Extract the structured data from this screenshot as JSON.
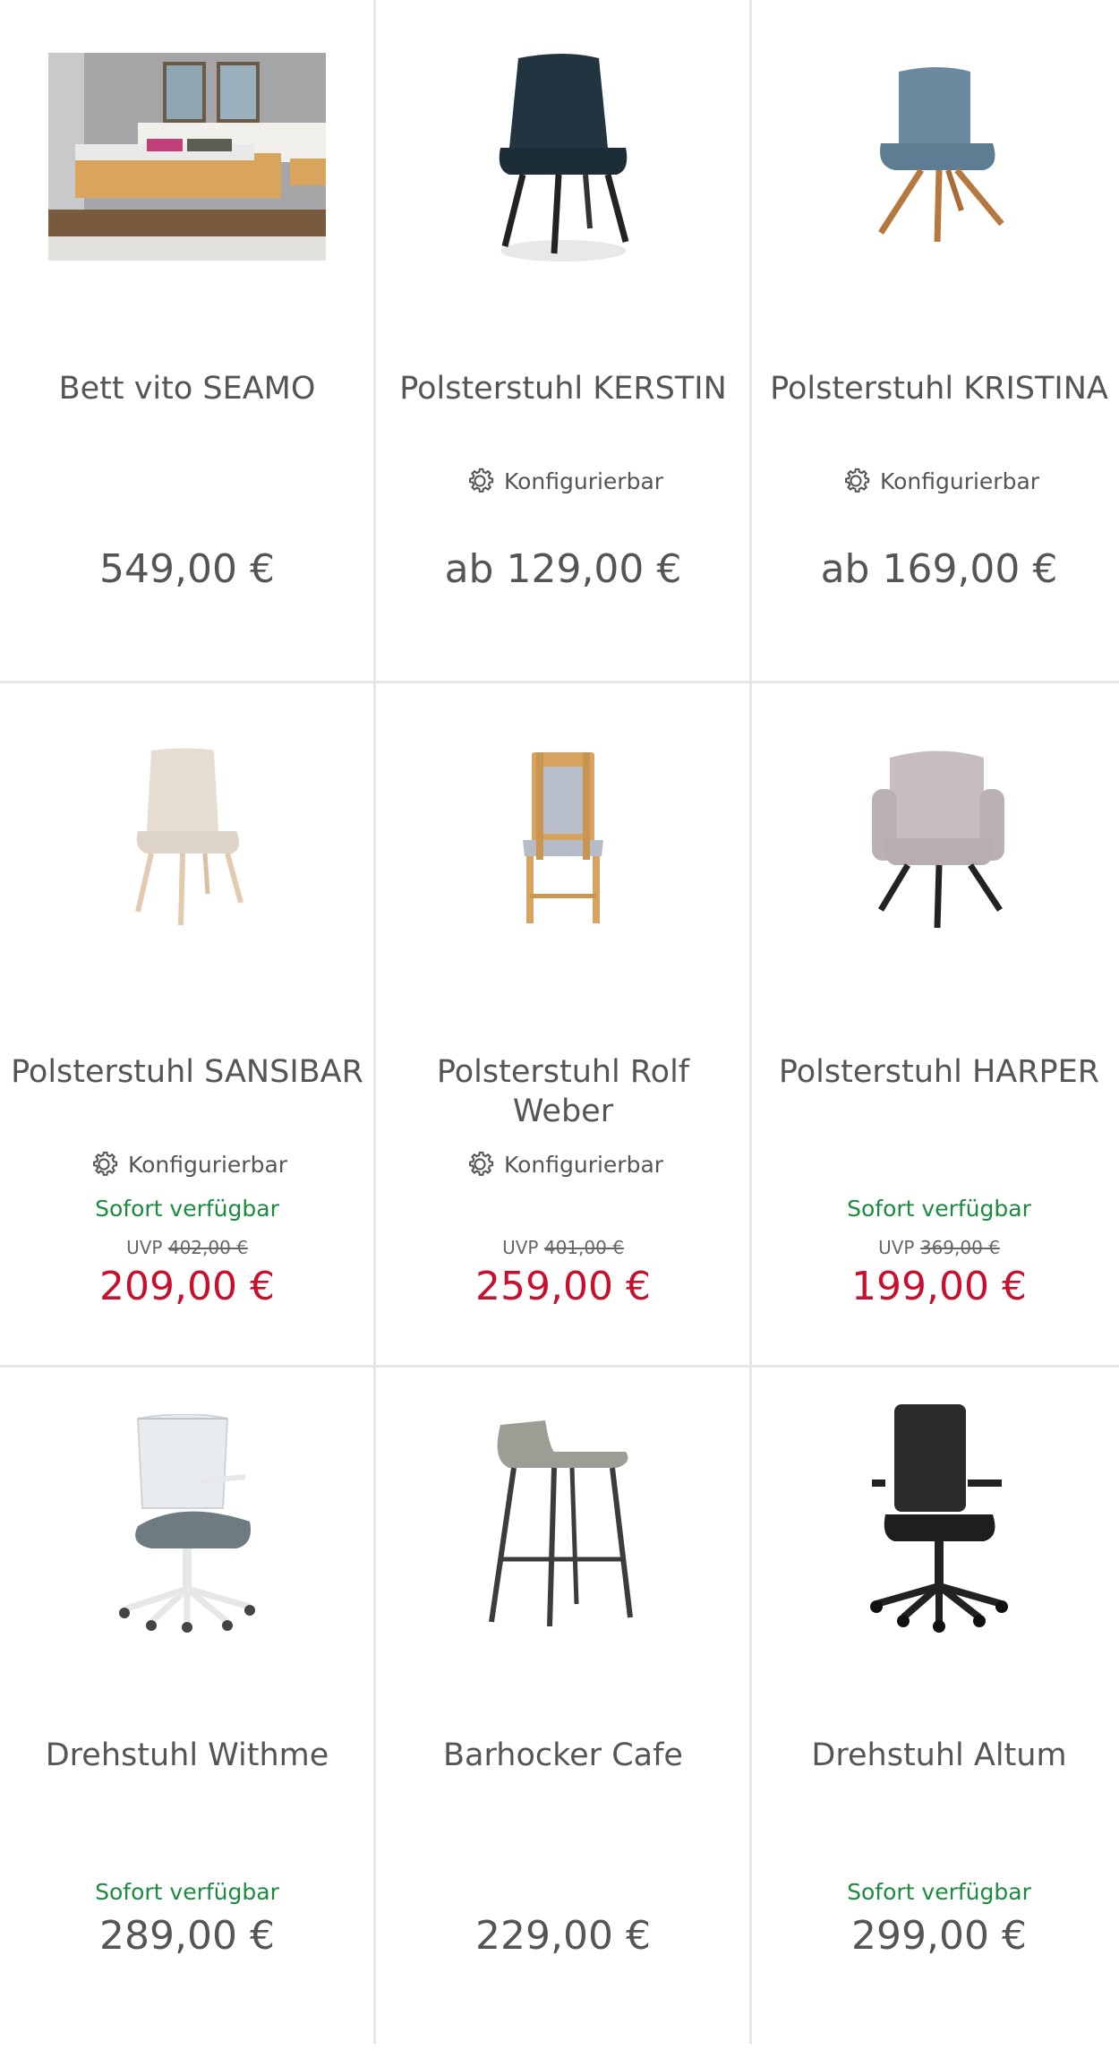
{
  "products": [
    {
      "title": "Bett vito SEAMO",
      "price": "549,00 €"
    },
    {
      "title": "Polsterstuhl KERSTIN",
      "config": "Konfigurierbar",
      "price": "ab 129,00 €"
    },
    {
      "title": "Polsterstuhl KRISTINA",
      "config": "Konfigurierbar",
      "price": "ab 169,00 €"
    },
    {
      "title": "Polsterstuhl SANSIBAR",
      "config": "Konfigurierbar",
      "availability": "Sofort verfügbar",
      "uvp_label": "UVP",
      "uvp": "402,00 €",
      "price": "209,00 €"
    },
    {
      "title": "Polsterstuhl Rolf Weber",
      "config": "Konfigurierbar",
      "uvp_label": "UVP",
      "uvp": "401,00 €",
      "price": "259,00 €"
    },
    {
      "title": "Polsterstuhl HARPER",
      "availability": "Sofort verfügbar",
      "uvp_label": "UVP",
      "uvp": "369,00 €",
      "price": "199,00 €"
    },
    {
      "title": "Drehstuhl Withme",
      "availability": "Sofort verfügbar",
      "price": "289,00 €"
    },
    {
      "title": "Barhocker Cafe",
      "price": "229,00 €"
    },
    {
      "title": "Drehstuhl Altum",
      "availability": "Sofort verfügbar",
      "price": "299,00 €"
    }
  ],
  "colors": {
    "availability": "#1c8a3f",
    "sale_price": "#c8102e",
    "text": "#555555",
    "divider": "#e6e6e6"
  }
}
